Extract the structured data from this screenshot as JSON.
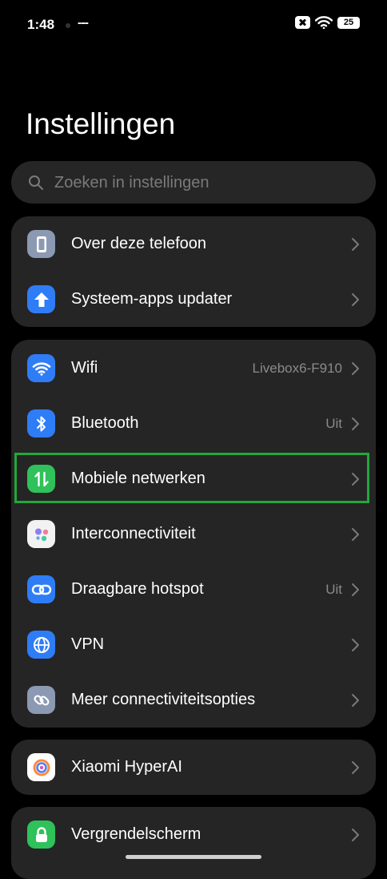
{
  "status_bar": {
    "time": "1:48",
    "notif_indicator": "---",
    "battery": "25"
  },
  "title": "Instellingen",
  "search": {
    "placeholder": "Zoeken in instellingen"
  },
  "sections": [
    {
      "items": [
        {
          "label": "Over deze telefoon",
          "icon": "phone-icon",
          "icon_bg": "#8b99b3"
        },
        {
          "label": "Systeem-apps updater",
          "icon": "arrow-up-icon",
          "icon_bg": "#2f7df6"
        }
      ]
    },
    {
      "items": [
        {
          "label": "Wifi",
          "value": "Livebox6-F910",
          "icon": "wifi-icon",
          "icon_bg": "#2f7df6"
        },
        {
          "label": "Bluetooth",
          "value": "Uit",
          "icon": "bluetooth-icon",
          "icon_bg": "#2f7df6"
        },
        {
          "label": "Mobiele netwerken",
          "icon": "mobile-data-icon",
          "icon_bg": "#2fc15a",
          "highlighted": true
        },
        {
          "label": "Interconnectiviteit",
          "icon": "interconnectivity-icon",
          "icon_bg": "#f2f2f2"
        },
        {
          "label": "Draagbare hotspot",
          "value": "Uit",
          "icon": "hotspot-icon",
          "icon_bg": "#2f7df6"
        },
        {
          "label": "VPN",
          "icon": "globe-icon",
          "icon_bg": "#2f7df6"
        },
        {
          "label": "Meer connectiviteitsopties",
          "icon": "link-icon",
          "icon_bg": "#8b99b3"
        }
      ]
    },
    {
      "items": [
        {
          "label": "Xiaomi HyperAI",
          "icon": "hyperai-icon",
          "icon_bg": "#ffffff"
        }
      ]
    },
    {
      "items": [
        {
          "label": "Vergrendelscherm",
          "icon": "lock-icon",
          "icon_bg": "#2fc15a"
        }
      ]
    }
  ],
  "colors": {
    "background": "#000000",
    "card": "#252525",
    "accent_blue": "#2f7df6",
    "accent_green": "#2fc15a",
    "highlight": "#21a83a"
  }
}
